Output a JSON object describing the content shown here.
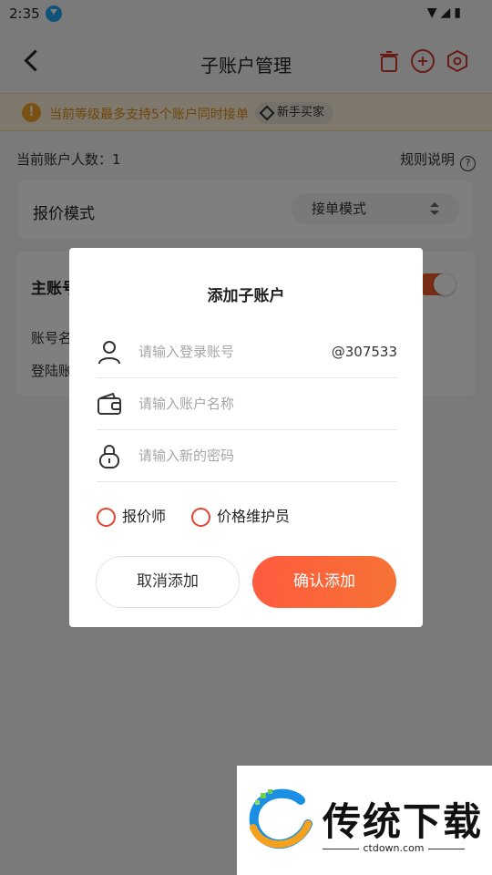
{
  "status_bar": {
    "time": "2:35"
  },
  "navbar": {
    "title": "子账户管理"
  },
  "notice": {
    "text": "当前等级最多支持5个账户同时接单",
    "tag": "新手买家"
  },
  "summary": {
    "count_label": "当前账户人数：1",
    "rule_label": "规则说明"
  },
  "mode": {
    "label": "报价模式",
    "selected": "接单模式"
  },
  "main_account": {
    "title": "主账号",
    "row1": "账号名",
    "row2": "登陆账"
  },
  "dialog": {
    "title": "添加子账户",
    "login_placeholder": "请输入登录账号",
    "login_suffix": "@307533",
    "name_placeholder": "请输入账户名称",
    "password_placeholder": "请输入新的密码",
    "roles": [
      "报价师",
      "价格维护员"
    ],
    "cancel_label": "取消添加",
    "confirm_label": "确认添加"
  },
  "watermark": {
    "brand": "传统下载",
    "url": "ctdown.com"
  },
  "colors": {
    "accent": "#f25b2a",
    "notice_text": "#e08a16",
    "notice_bg": "#fdf3d9",
    "radio": "#e8432f"
  },
  "icons": [
    "back-icon",
    "trash-icon",
    "add-circle-icon",
    "setting-hex-icon",
    "warning-icon",
    "diamond-icon",
    "help-icon",
    "sort-icon",
    "user-icon",
    "wallet-icon",
    "lock-icon"
  ]
}
